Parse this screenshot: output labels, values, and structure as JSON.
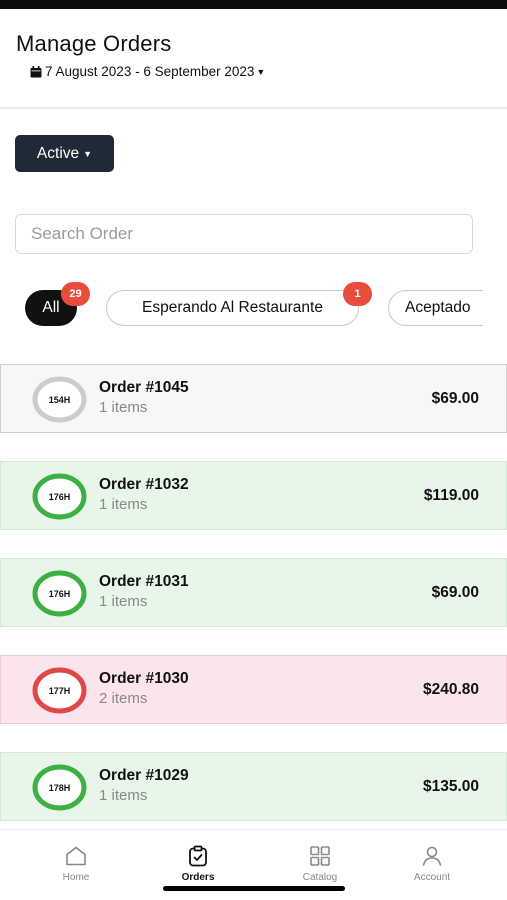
{
  "header": {
    "title": "Manage Orders",
    "date_range": "7 August 2023 - 6 September 2023"
  },
  "status_filter": {
    "label": "Active"
  },
  "search": {
    "placeholder": "Search Order",
    "value": ""
  },
  "chips": [
    {
      "label": "All",
      "count": "29"
    },
    {
      "label": "Esperando Al Restaurante",
      "count": "1"
    },
    {
      "label": "Aceptado"
    }
  ],
  "orders": [
    {
      "hours": "154H",
      "title": "Order #1045",
      "items": "1 items",
      "price": "$69.00",
      "status_color": "#cccccc"
    },
    {
      "hours": "176H",
      "title": "Order #1032",
      "items": "1 items",
      "price": "$119.00",
      "status_color": "#3cb043"
    },
    {
      "hours": "176H",
      "title": "Order #1031",
      "items": "1 items",
      "price": "$69.00",
      "status_color": "#3cb043"
    },
    {
      "hours": "177H",
      "title": "Order #1030",
      "items": "2 items",
      "price": "$240.80",
      "status_color": "#e04848"
    },
    {
      "hours": "178H",
      "title": "Order #1029",
      "items": "1 items",
      "price": "$135.00",
      "status_color": "#3cb043"
    }
  ],
  "nav": {
    "home": "Home",
    "orders": "Orders",
    "catalog": "Catalog",
    "account": "Account"
  },
  "colors": {
    "accent": "#1f2937",
    "badge": "#e74c3c",
    "ring_green": "#3cb043",
    "ring_red": "#e04848",
    "ring_grey": "#cccccc"
  }
}
